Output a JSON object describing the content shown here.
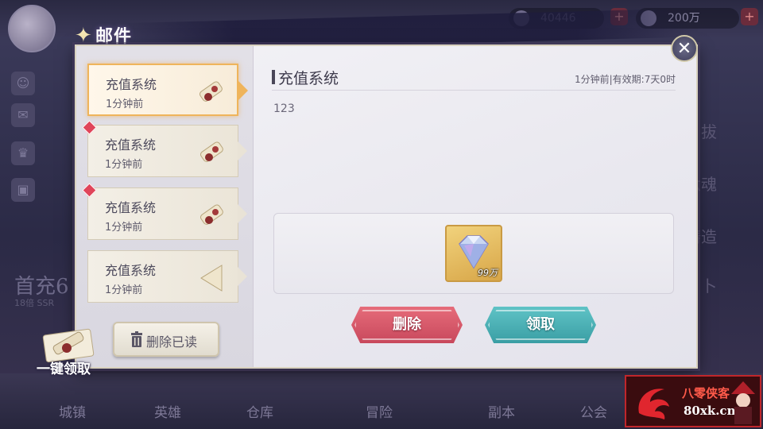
{
  "background": {
    "resources": [
      {
        "icon": "power-icon",
        "value": "40446"
      },
      {
        "icon": "gem-icon",
        "value": "200万"
      }
    ],
    "right_labels": [
      "拔",
      "六魂",
      "铸造",
      "卜"
    ],
    "first_recharge": {
      "title": "首充6",
      "subtitle": "18倍 SSR"
    },
    "bottom_nav": [
      "城镇",
      "英雄",
      "仓库",
      "冒险",
      "副本",
      "公会"
    ]
  },
  "mail": {
    "title": "邮件",
    "items": [
      {
        "sender": "充值系统",
        "time": "1分钟前",
        "selected": true,
        "unread": false
      },
      {
        "sender": "充值系统",
        "time": "1分钟前",
        "selected": false,
        "unread": true
      },
      {
        "sender": "充值系统",
        "time": "1分钟前",
        "selected": false,
        "unread": true
      },
      {
        "sender": "充值系统",
        "time": "1分钟前",
        "selected": false,
        "unread": false
      }
    ],
    "claim_all_label": "一键领取",
    "delete_read_label": "删除已读"
  },
  "detail": {
    "sender": "充值系统",
    "meta": "1分钟前|有效期:7天0时",
    "body": "123",
    "reward": {
      "icon": "diamond-icon",
      "quantity": "99万"
    },
    "delete_label": "删除",
    "claim_label": "领取"
  },
  "watermark": {
    "line1": "八零侠客",
    "line2": "80xk.cn"
  },
  "colors": {
    "accent_gold": "#efb45b",
    "delete_red": "#d65567",
    "claim_teal": "#4bb1b5",
    "unread": "#e0455a"
  }
}
